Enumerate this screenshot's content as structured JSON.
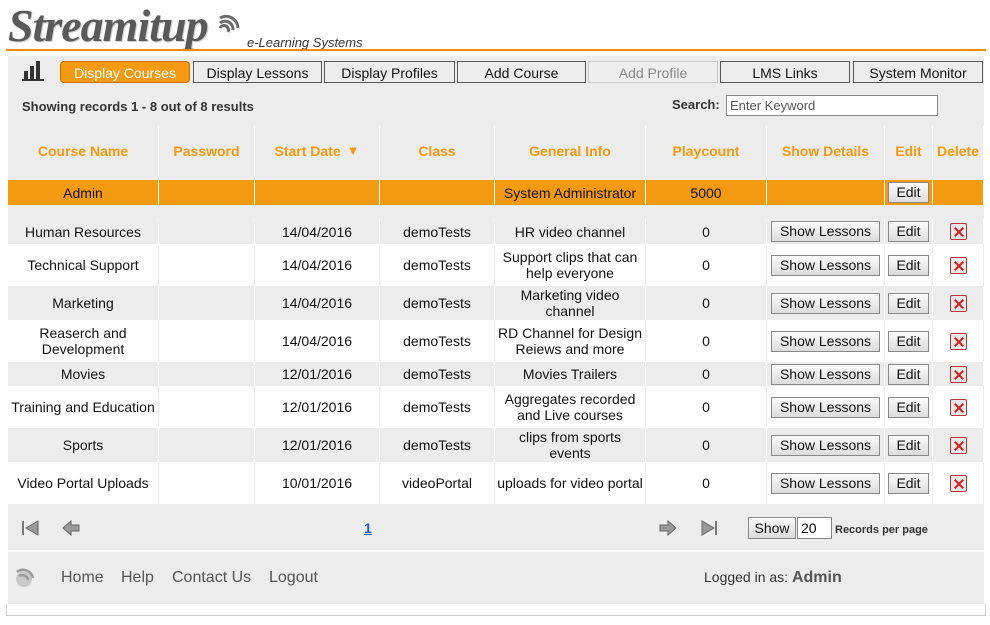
{
  "brand": {
    "name": "Streamitup",
    "tagline": "e-Learning Systems",
    "accent": "#f39a10"
  },
  "nav": {
    "icon": "bar-chart-icon",
    "items": [
      {
        "label": "Display Courses",
        "state": "active"
      },
      {
        "label": "Display Lessons",
        "state": "normal"
      },
      {
        "label": "Display Profiles",
        "state": "normal"
      },
      {
        "label": "Add Course",
        "state": "normal"
      },
      {
        "label": "Add Profile",
        "state": "disabled"
      },
      {
        "label": "LMS Links",
        "state": "normal"
      },
      {
        "label": "System Monitor",
        "state": "normal"
      }
    ]
  },
  "records_text": "Showing records 1 - 8 out of 8 results",
  "search": {
    "label": "Search:",
    "placeholder": "Enter Keyword"
  },
  "table": {
    "headers": [
      "Course Name",
      "Password",
      "Start Date",
      "Class",
      "General Info",
      "Playcount",
      "Show Details",
      "Edit",
      "Delete"
    ],
    "sort_indicator": "▼",
    "show_lessons_label": "Show Lessons",
    "edit_label": "Edit",
    "admin_row": {
      "name": "Admin",
      "password": "",
      "start_date": "",
      "class": "",
      "info": "System Administrator",
      "playcount": "5000"
    },
    "rows": [
      {
        "name": "Human Resources",
        "password": "",
        "start_date": "14/04/2016",
        "class": "demoTests",
        "info": "HR video channel",
        "playcount": "0"
      },
      {
        "name": "Technical Support",
        "password": "",
        "start_date": "14/04/2016",
        "class": "demoTests",
        "info": "Support clips that can help everyone",
        "playcount": "0"
      },
      {
        "name": "Marketing",
        "password": "",
        "start_date": "14/04/2016",
        "class": "demoTests",
        "info": "Marketing video channel",
        "playcount": "0"
      },
      {
        "name": "Reaserch and Development",
        "password": "",
        "start_date": "14/04/2016",
        "class": "demoTests",
        "info": "RD Channel for Design Reiews and more",
        "playcount": "0"
      },
      {
        "name": "Movies",
        "password": "",
        "start_date": "12/01/2016",
        "class": "demoTests",
        "info": "Movies Trailers",
        "playcount": "0"
      },
      {
        "name": "Training and Education",
        "password": "",
        "start_date": "12/01/2016",
        "class": "demoTests",
        "info": "Aggregates recorded and Live courses",
        "playcount": "0"
      },
      {
        "name": "Sports",
        "password": "",
        "start_date": "12/01/2016",
        "class": "demoTests",
        "info": "clips from sports events",
        "playcount": "0"
      },
      {
        "name": "Video Portal Uploads",
        "password": "",
        "start_date": "10/01/2016",
        "class": "videoPortal",
        "info": "uploads for video portal",
        "playcount": "0"
      }
    ]
  },
  "pager": {
    "current_page": "1",
    "show_label": "Show",
    "per_page_value": "20",
    "per_page_label": "Records per page"
  },
  "footer": {
    "links": [
      "Home",
      "Help",
      "Contact Us",
      "Logout"
    ],
    "logged_label": "Logged in as:",
    "user": "Admin"
  }
}
